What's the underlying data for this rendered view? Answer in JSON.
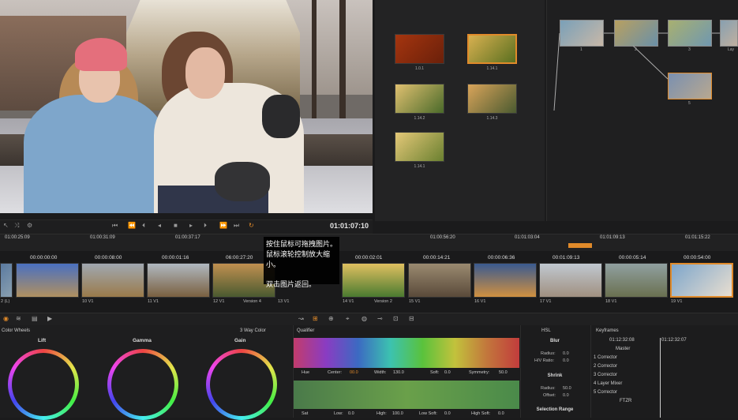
{
  "viewer": {
    "timecode": "01:01:07:10"
  },
  "gallery": {
    "stills": [
      {
        "label": "1.0.1"
      },
      {
        "label": "1.14.1"
      },
      {
        "label": "1.14.2"
      },
      {
        "label": "1.14.3"
      },
      {
        "label": "1.14.1"
      }
    ]
  },
  "nodes": {
    "labels": [
      "1",
      "2",
      "3",
      "4",
      "5"
    ],
    "extra": "Lay"
  },
  "timeline": {
    "marks": [
      "01:00:25:09",
      "01:00:31:09",
      "01:00:37:17",
      "",
      "",
      "01:00:56:20",
      "",
      "01:01:03:04",
      "01:01:09:13",
      "01:01:15:22"
    ]
  },
  "clips": {
    "timecodes": [
      "00:00:00:00",
      "00:00:08:00",
      "00:00:01:16",
      "06:00:27:20",
      "",
      "00:00:02:01",
      "00:00:14:21",
      "00:00:06:36",
      "00:01:09:13",
      "00:00:05:14",
      "00:00:54:00"
    ],
    "labels": [
      "2 (L)",
      "10 V1",
      "11 V1",
      "12 V1",
      "Version 4",
      "13 V1",
      "14 V1",
      "Version 2",
      "15 V1",
      "16 V1",
      "17 V1",
      "18 V1",
      "19 V1"
    ]
  },
  "tooltip": {
    "line1": "按住鼠标可拖拽图片。",
    "line2": "鼠标滚轮控制放大缩小。",
    "line3": "双击图片返回。"
  },
  "wheels": {
    "title": "Color Wheels",
    "mode": "3 Way Color",
    "lift": "Lift",
    "gamma": "Gamma",
    "gain": "Gain"
  },
  "qualifier": {
    "title": "Qualifier",
    "hue": "Hue",
    "center": "Center:",
    "center_val": "00.0",
    "width": "Width:",
    "width_val": "130.0",
    "soft": "Soft:",
    "soft_val": "0.0",
    "sym": "Symmetry:",
    "sym_val": "50.0",
    "sat": "Sat",
    "low": "Low:",
    "low_val": "0.0",
    "high": "High:",
    "high_val": "100.0",
    "lowsoft": "Low Soft:",
    "lowsoft_val": "0.0",
    "highsoft": "High Soft:",
    "highsoft_val": "0.0"
  },
  "blur": {
    "mode": "HSL",
    "blur": "Blur",
    "radius": "Radius:",
    "radius_val": "0.0",
    "hv": "H/V Ratio:",
    "hv_val": "0.0",
    "shrink": "Shrink",
    "s_radius": "Radius:",
    "s_radius_val": "50.0",
    "offset": "Offset:",
    "offset_val": "0.0",
    "selrange": "Selection Range"
  },
  "keyframes": {
    "title": "Keyframes",
    "tc1": "01:12:32:08",
    "tc2": "01:12:32:07",
    "master": "Master",
    "rows": [
      "1 Corrector",
      "2 Corrector",
      "3 Corrector",
      "4 Layer Mixer",
      "5 Corrector",
      "FTZR"
    ]
  }
}
